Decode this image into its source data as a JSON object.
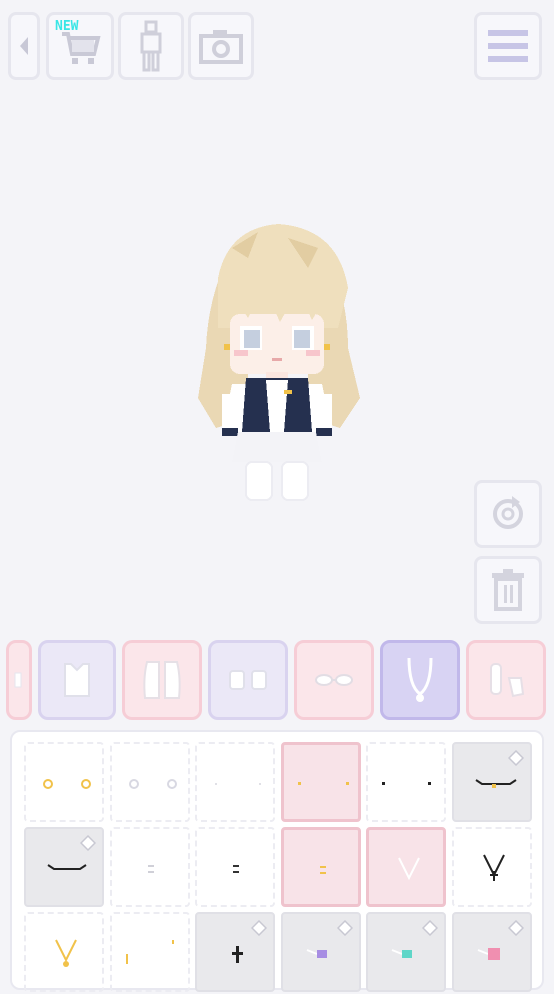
{
  "toolbar": {
    "new_badge": "NEW",
    "icons": [
      "back-arrow-icon",
      "shop-cart-icon",
      "body-icon",
      "camera-icon",
      "menu-icon"
    ]
  },
  "side_tools": {
    "icons": [
      "rotate-icon",
      "trash-icon"
    ]
  },
  "categories": {
    "items": [
      "hat-partial",
      "top",
      "jacket",
      "socks",
      "glasses",
      "necklace",
      "earring-accessory"
    ],
    "selected": "necklace"
  },
  "items_grid": {
    "rows": 3,
    "cols": 6,
    "selected_cells": [
      3,
      9,
      10
    ],
    "premium_cells": [
      5,
      6,
      14,
      15,
      16,
      17
    ]
  },
  "colors": {
    "background": "#f4f4f8",
    "accent_lavender": "#d8d3f3",
    "accent_pink": "#fbe6ea",
    "badge": "#39e6e6"
  }
}
